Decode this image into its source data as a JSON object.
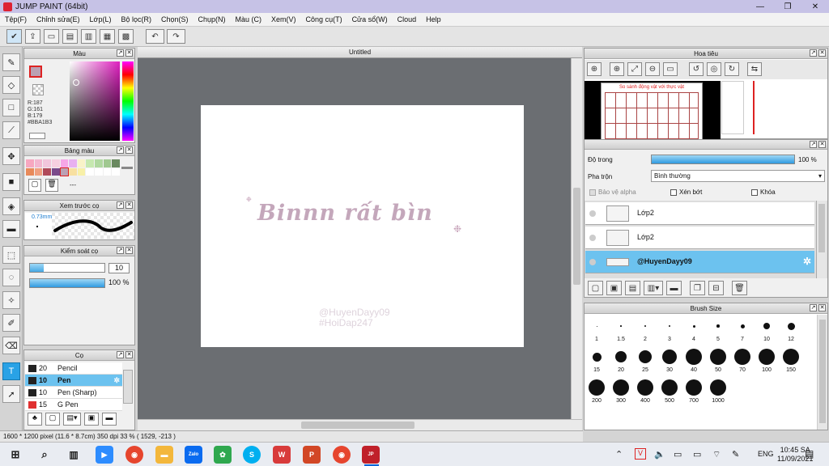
{
  "window": {
    "title": "JUMP PAINT (64bit)",
    "minimize": "—",
    "restore": "❐",
    "close": "✕"
  },
  "menu": [
    "Tệp(F)",
    "Chỉnh sửa(E)",
    "Lớp(L)",
    "Bộ lọc(R)",
    "Chọn(S)",
    "Chụp(N)",
    "Màu (C)",
    "Xem(V)",
    "Công cụ(T)",
    "Cửa sổ(W)",
    "Cloud",
    "Help"
  ],
  "color_panel": {
    "title": "Màu",
    "r": "R:187",
    "g": "G:161",
    "b": "B:179",
    "hex": "#BBA1B3",
    "swatch": "#bba1b3"
  },
  "palette_panel": {
    "title": "Bảng màu",
    "more": "---"
  },
  "preview_panel": {
    "title": "Xem trước cọ",
    "size": "0.73mm"
  },
  "brush_control": {
    "title": "Kiểm soát cọ",
    "size": "10",
    "density": "100 %"
  },
  "brush_list": {
    "title": "Cọ",
    "items": [
      {
        "size": "20",
        "name": "Pencil",
        "color": "#222222"
      },
      {
        "size": "10",
        "name": "Pen",
        "color": "#222222"
      },
      {
        "size": "10",
        "name": "Pen (Sharp)",
        "color": "#222222"
      },
      {
        "size": "15",
        "name": "G Pen",
        "color": "#e03030"
      }
    ]
  },
  "document": {
    "tab": "Untitled",
    "headline": "Binnn rất bìn",
    "watermark1": "@HuyenDayy09",
    "watermark2": "#HoiDap247"
  },
  "status": "1600 * 1200 pixel   (11.6 * 8.7cm)   350 dpi   33 %   ( 1529, -213 )",
  "navigator": {
    "title": "Hoa tiêu",
    "thumb_title": "So sánh động vật với thực vật"
  },
  "layer_panel": {
    "opacity_label": "Độ trong",
    "opacity": "100 %",
    "blend_label": "Pha trộn",
    "blend": "Bình thường",
    "protect_alpha": "Bảo vệ alpha",
    "clip": "Xén bớt",
    "lock": "Khóa",
    "layers": [
      "Lớp2",
      "Lớp2",
      "@HuyenDayy09"
    ]
  },
  "brush_size": {
    "title": "Brush Size",
    "sizes": [
      [
        "1",
        "1.5",
        "2",
        "3",
        "4",
        "5",
        "7",
        "10",
        "12"
      ],
      [
        "15",
        "20",
        "25",
        "30",
        "40",
        "50",
        "70",
        "100",
        "150"
      ],
      [
        "200",
        "300",
        "400",
        "500",
        "700",
        "1000"
      ]
    ]
  },
  "taskbar": {
    "lang": "ENG",
    "time": "10:45 SA",
    "date": "11/09/2021"
  }
}
